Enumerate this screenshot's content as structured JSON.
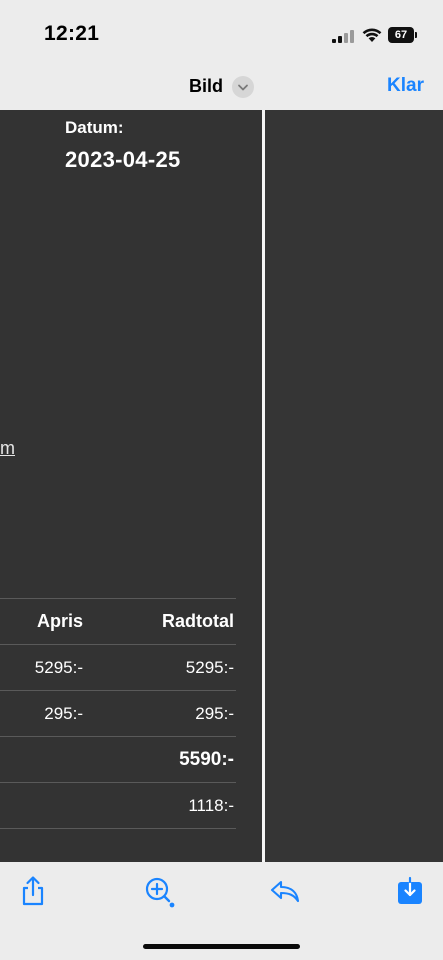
{
  "status": {
    "time": "12:21",
    "battery": "67"
  },
  "nav": {
    "title": "Bild",
    "done": "Klar"
  },
  "document": {
    "date_label": "Datum:",
    "date_value": "2023-04-25",
    "link_fragment": "m",
    "table": {
      "headers": [
        "Apris",
        "Radtotal"
      ],
      "rows": [
        {
          "apris": "5295:-",
          "radtotal": "5295:-"
        },
        {
          "apris": "295:-",
          "radtotal": "295:-"
        },
        {
          "apris": "",
          "radtotal": "5590:-"
        },
        {
          "apris": "",
          "radtotal": "1118:-"
        }
      ]
    }
  },
  "toolbar": {
    "icons": [
      "share-icon",
      "markup-icon",
      "reply-icon",
      "save-icon"
    ]
  },
  "colors": {
    "accent": "#1a84ff",
    "doc_background": "#333333"
  }
}
